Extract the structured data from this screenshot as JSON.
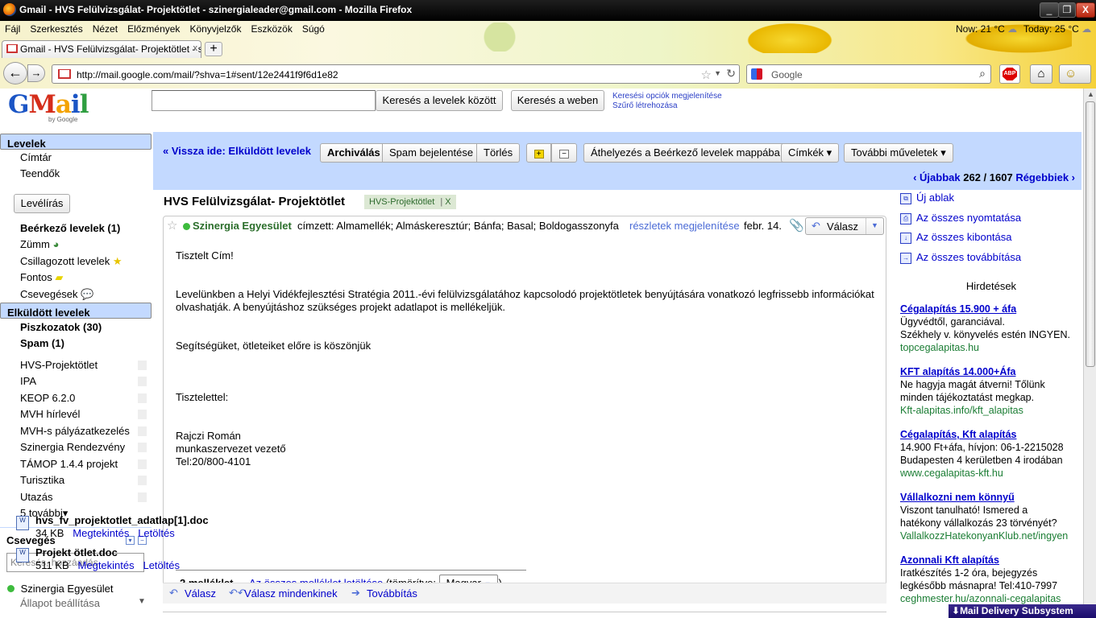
{
  "window": {
    "title": "Gmail - HVS Felülvizsgálat- Projektötlet - szinergialeader@gmail.com - Mozilla Firefox",
    "min": "_",
    "max": "❐",
    "close": "X"
  },
  "menu": [
    "Fájl",
    "Szerkesztés",
    "Nézet",
    "Előzmények",
    "Könyvjelzők",
    "Eszközök",
    "Súgó"
  ],
  "weather": {
    "now": "Now: 21 °C",
    "today": "Today: 25 °C"
  },
  "tab": {
    "title": "Gmail - HVS Felülvizsgálat- Projektötlet - szin...",
    "close": "x",
    "new": "+"
  },
  "nav": {
    "url": "http://mail.google.com/mail/?shva=1#sent/12e2441f9f6d1e82",
    "search_placeholder": "Google"
  },
  "gmail": {
    "logo": {
      "g": "G",
      "m": "M",
      "a": "a",
      "i": "i",
      "l": "l"
    },
    "by": "by Google",
    "search_mail": "Keresés a levelek között",
    "search_web": "Keresés a weben",
    "search_options": "Keresési opciók megjelenítése",
    "create_filter": "Szűrő létrehozása"
  },
  "sidebar": {
    "top": [
      "Levelek",
      "Címtár",
      "Teendők"
    ],
    "compose": "Levélírás",
    "folders": [
      {
        "label": "Beérkező levelek (1)",
        "bold": true
      },
      {
        "label": "Zümm",
        "bold": false
      },
      {
        "label": "Csillagozott levelek",
        "bold": false
      },
      {
        "label": "Fontos",
        "bold": false
      },
      {
        "label": "Csevegések",
        "bold": false
      },
      {
        "label": "Elküldött levelek",
        "bold": true
      },
      {
        "label": "Piszkozatok (30)",
        "bold": true
      },
      {
        "label": "Spam (1)",
        "bold": true
      }
    ],
    "labels": [
      "HVS-Projektötlet",
      "IPA",
      "KEOP 6.2.0",
      "MVH hírlevél",
      "MVH-s pályázatkezelés",
      "Szinergia Rendezvény",
      "TÁMOP 1.4.4 projekt",
      "Turisztika",
      "Utazás"
    ],
    "more": "5 további▾",
    "chat_title": "Csevegés",
    "chat_search": "Keresés, hozzáadás",
    "chat_user": "Szinergia Egyesület",
    "status": "Állapot beállítása"
  },
  "toolbar": {
    "back": "« Vissza ide: Elküldött levelek",
    "archive": "Archiválás",
    "spam": "Spam bejelentése",
    "delete": "Törlés",
    "move": "Áthelyezés a Beérkező levelek mappába",
    "labels": "Címkék ▾",
    "more": "További műveletek ▾",
    "newer": "‹ Újabbak",
    "count": "262 / 1607",
    "older": "Régebbiek ›"
  },
  "message": {
    "subject": "HVS Felülvizsgálat- Projektötlet",
    "label": "HVS-Projektötlet",
    "label_x": "X",
    "sender": "Szinergia Egyesület",
    "to": "címzett: Almamellék; Almáskeresztúr; Bánfa; Basal; Boldogasszonyfa",
    "details": "részletek megjelenítése",
    "date": "febr. 14.",
    "reply": "Válasz",
    "body": [
      "Tisztelt Cím!",
      "Levelünkben a Helyi Vidékfejlesztési Stratégia 2011.-évi felülvizsgálatához kapcsolodó projektötletek benyújtására vonatkozó legfrissebb információkat olvashatják. A benyújtáshoz szükséges projekt adatlapot is mellékeljük.",
      "Segítségüket, ötleteiket előre is köszönjük",
      "Tisztelettel:",
      "Rajczi Román",
      "munkaszervezet vezető",
      "Tel:20/800-4101"
    ],
    "attach_count": "2 melléklet",
    "attach_sep": " — ",
    "download_all": "Az összes melléklet letöltése",
    "zipped": " (tömörítve:",
    "lang": "Magyar",
    "close_paren": ")",
    "files": [
      {
        "name": "hvs_fv_projektotlet_adatlap[1].doc",
        "size": "34 KB",
        "view": "Megtekintés",
        "download": "Letöltés"
      },
      {
        "name": "Projekt ötlet.doc",
        "size": "511 KB",
        "view": "Megtekintés",
        "download": "Letöltés"
      }
    ],
    "footer": {
      "reply": "Válasz",
      "reply_all": "Válasz mindenkinek",
      "forward": "Továbbítás"
    }
  },
  "right": {
    "actions": [
      "Új ablak",
      "Az összes nyomtatása",
      "Az összes kibontása",
      "Az összes továbbítása"
    ],
    "ads_title": "Hirdetések",
    "ads": [
      {
        "title": "Cégalapítás 15.900 + áfa",
        "text": [
          "Ügyvédtől, garanciával.",
          "Székhely v. könyvelés estén INGYEN."
        ],
        "url": "topcegalapitas.hu"
      },
      {
        "title": "KFT alapítás 14.000+Áfa",
        "text": [
          "Ne hagyja magát átverni! Tőlünk",
          "minden tájékoztatást megkap."
        ],
        "url": "Kft-alapitas.info/kft_alapitas"
      },
      {
        "title": "Cégalapítás, Kft alapítás",
        "text": [
          "14.900 Ft+áfa, hívjon: 06-1-2215028",
          "Budapesten 4 kerületben 4 irodában"
        ],
        "url": "www.cegalapitas-kft.hu"
      },
      {
        "title": "Vállalkozni nem könnyű",
        "text": [
          "Viszont tanulható! Ismered a",
          "hatékony vállalkozás 23 törvényét?"
        ],
        "url": "VallalkozzHatekonyanKlub.net/ingyen"
      },
      {
        "title": "Azonnali Kft alapítás",
        "text": [
          "Iratkészítés 1-2 óra, bejegyzés",
          "legkésőbb másnapra! Tel:410-7997"
        ],
        "url": "ceghmester.hu/azonnali-cegalapitas"
      }
    ]
  },
  "mds": "Mail Delivery Subsystem"
}
